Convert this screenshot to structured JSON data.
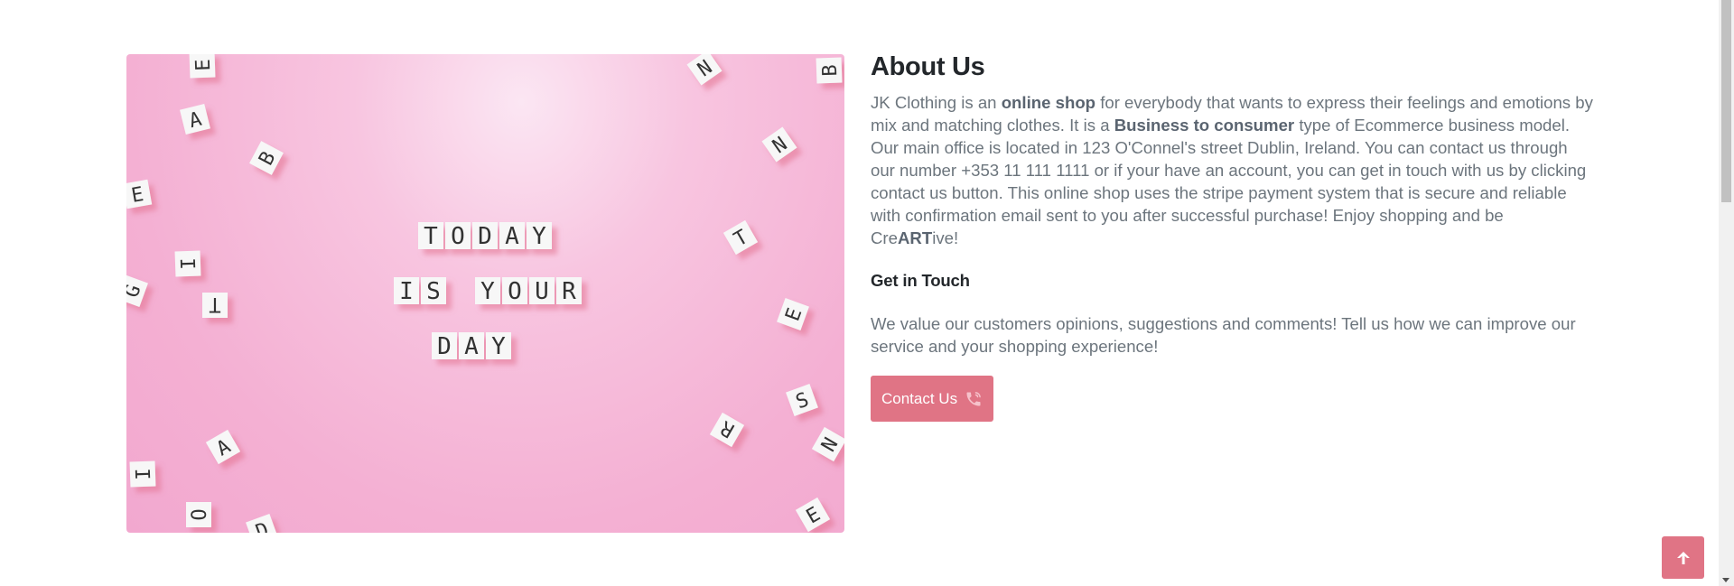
{
  "hero": {
    "image_alt": "Pink background with letter tiles",
    "tile_lines": [
      "TODAY",
      "IS YOUR",
      "DAY"
    ]
  },
  "about": {
    "title": "About Us",
    "text_parts": {
      "p1": "JK Clothing is an ",
      "b1": "online shop",
      "p2": " for everybody that wants to express their feelings and emotions by mix and matching clothes. It is a ",
      "b2": "Business to consumer",
      "p3": " type of Ecommerce business model. Our main office is located in 123 O'Connel's street Dublin, Ireland. You can contact us through our number +353 11 111 1111 or if your have an account, you can get in touch with us by clicking contact us button. This online shop uses the stripe payment system that is secure and reliable with confirmation email sent to you after successful purchase! Enjoy shopping and be Cre",
      "b3": "ART",
      "p4": "ive!"
    }
  },
  "touch": {
    "title": "Get in Touch",
    "text": "We value our customers opinions, suggestions and comments! Tell us how we can improve our service and your shopping experience!",
    "button_label": "Contact Us",
    "button_icon": "phone-icon"
  },
  "back_to_top": {
    "icon": "arrow-up-icon"
  },
  "colors": {
    "accent": "#e07485",
    "heading": "#23272b",
    "body_text": "#6c757d"
  }
}
